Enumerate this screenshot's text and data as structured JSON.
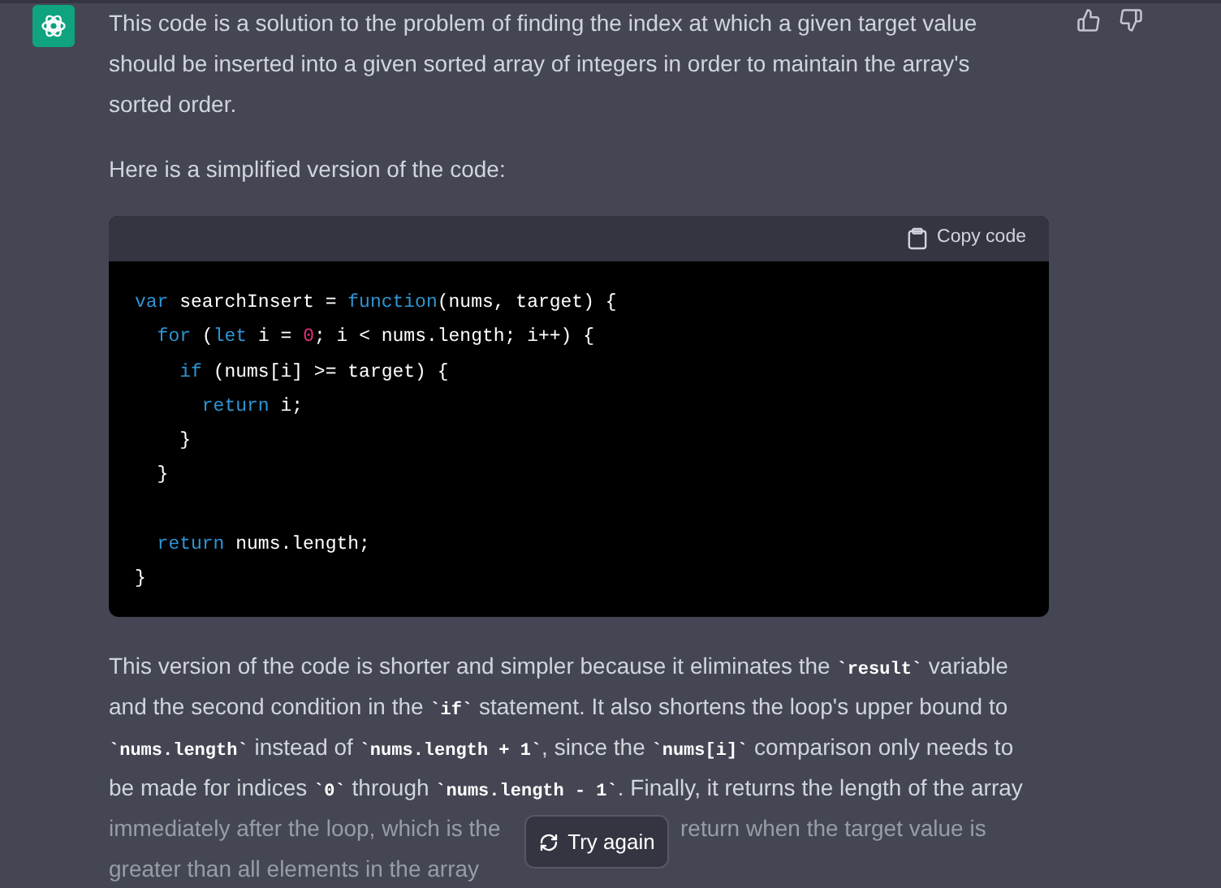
{
  "message": {
    "intro_lines": [
      "This code is a solution to the problem of finding the index at which a given target value",
      "should be inserted into a given sorted array of integers in order to maintain the array's",
      "sorted order."
    ],
    "lead": "Here is a simplified version of the code:",
    "code_block": {
      "copy_label": "Copy code",
      "lines": [
        {
          "kind": "code",
          "tokens": [
            {
              "kind": "keyword",
              "text": "var"
            },
            {
              "kind": "plain",
              "text": " searchInsert = "
            },
            {
              "kind": "keyword",
              "text": "function"
            },
            {
              "kind": "plain",
              "text": "(nums, target) {"
            }
          ]
        },
        {
          "kind": "code",
          "tokens": [
            {
              "kind": "keyword",
              "text": "  for"
            },
            {
              "kind": "plain",
              "text": " ("
            },
            {
              "kind": "keyword",
              "text": "let"
            },
            {
              "kind": "plain",
              "text": " i = "
            },
            {
              "kind": "number",
              "text": "0"
            },
            {
              "kind": "plain",
              "text": "; i < nums.length; i++) {"
            }
          ]
        },
        {
          "kind": "code",
          "tokens": [
            {
              "kind": "keyword",
              "text": "    if"
            },
            {
              "kind": "plain",
              "text": " (nums[i] >= target) {"
            }
          ]
        },
        {
          "kind": "code",
          "tokens": [
            {
              "kind": "keyword",
              "text": "      return"
            },
            {
              "kind": "plain",
              "text": " i;"
            }
          ]
        },
        {
          "kind": "code",
          "tokens": [
            {
              "kind": "plain",
              "text": "    }"
            }
          ]
        },
        {
          "kind": "code",
          "tokens": [
            {
              "kind": "plain",
              "text": "  }"
            }
          ]
        },
        {
          "kind": "blank"
        },
        {
          "kind": "code",
          "tokens": [
            {
              "kind": "keyword",
              "text": "  return"
            },
            {
              "kind": "plain",
              "text": " nums.length;"
            }
          ]
        },
        {
          "kind": "code",
          "tokens": [
            {
              "kind": "plain",
              "text": "}"
            }
          ]
        }
      ]
    },
    "explanation_lines": [
      {
        "faded": false,
        "parts": [
          [
            {
              "kind": "text",
              "text": "This version of the code is shorter and simpler because it eliminates the "
            },
            {
              "kind": "code",
              "text": "`result`"
            },
            {
              "kind": "text",
              "text": " variable"
            }
          ]
        ]
      },
      {
        "faded": false,
        "parts": [
          [
            {
              "kind": "text",
              "text": "and the second condition in the "
            },
            {
              "kind": "code",
              "text": "`if`"
            },
            {
              "kind": "text",
              "text": " statement. It also shortens the loop's upper bound to"
            }
          ]
        ]
      },
      {
        "faded": false,
        "parts": [
          [
            {
              "kind": "code",
              "text": "`nums.length`"
            },
            {
              "kind": "text",
              "text": " instead of "
            },
            {
              "kind": "code",
              "text": "`nums.length + 1`"
            },
            {
              "kind": "text",
              "text": ", since the "
            },
            {
              "kind": "code",
              "text": "`nums[i]`"
            },
            {
              "kind": "text",
              "text": " comparison only needs to"
            }
          ]
        ]
      },
      {
        "faded": false,
        "parts": [
          [
            {
              "kind": "text",
              "text": "be made for indices "
            },
            {
              "kind": "code",
              "text": "`0`"
            },
            {
              "kind": "text",
              "text": " through "
            },
            {
              "kind": "code",
              "text": "`nums.length - 1`"
            },
            {
              "kind": "text",
              "text": ". Finally, it returns the length of the array"
            }
          ]
        ]
      },
      {
        "faded": true,
        "parts": [
          [
            {
              "kind": "text",
              "text": "immediately after the loop, which is the"
            }
          ],
          [
            {
              "kind": "text",
              "text": "return when the target value is"
            }
          ]
        ]
      },
      {
        "faded": true,
        "parts": [
          [
            {
              "kind": "text",
              "text": "greater than all elements in the array"
            }
          ]
        ]
      }
    ]
  },
  "try_again_button": {
    "label": "Try again"
  }
}
